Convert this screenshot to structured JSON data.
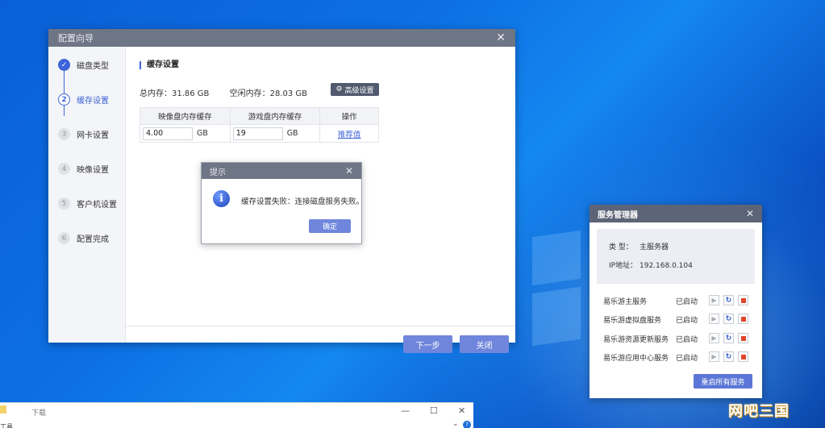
{
  "wizard": {
    "title": "配置向导",
    "steps": [
      {
        "num": "✓",
        "label": "磁盘类型",
        "state": "done"
      },
      {
        "num": "2",
        "label": "缓存设置",
        "state": "active"
      },
      {
        "num": "3",
        "label": "网卡设置",
        "state": "todo"
      },
      {
        "num": "4",
        "label": "映像设置",
        "state": "todo"
      },
      {
        "num": "5",
        "label": "客户机设置",
        "state": "todo"
      },
      {
        "num": "6",
        "label": "配置完成",
        "state": "todo"
      }
    ],
    "section_title": "缓存设置",
    "total_mem": "总内存：31.86 GB",
    "free_mem": "空闲内存：28.03 GB",
    "advanced_button": "高级设置",
    "table": {
      "headers": [
        "映像盘内存缓存",
        "游戏盘内存缓存",
        "操作"
      ],
      "image_cache_value": "4.00",
      "game_cache_value": "19",
      "unit": "GB",
      "action_link": "推荐值"
    },
    "next_button": "下一步",
    "close_button": "关闭"
  },
  "alert": {
    "title": "提示",
    "message": "缓存设置失败：连接磁盘服务失败。",
    "ok_button": "确定"
  },
  "service_manager": {
    "title": "服务管理器",
    "type_label": "类  型：",
    "type_value": "主服务器",
    "ip_label": "IP地址：",
    "ip_value": "192.168.0.104",
    "services": [
      {
        "name": "易乐游主服务",
        "status": "已启动"
      },
      {
        "name": "易乐游虚拟盘服务",
        "status": "已启动"
      },
      {
        "name": "易乐游资源更新服务",
        "status": "已启动"
      },
      {
        "name": "易乐游应用中心服务",
        "status": "已启动"
      }
    ],
    "restart_all_button": "重启所有服务"
  },
  "explorer": {
    "title": "下载",
    "left_label": "工具"
  },
  "watermark": "网吧三国",
  "colors": {
    "accent": "#3d64d8",
    "titlebar": "#6e7585",
    "button": "#6f86dc",
    "stop": "#e1462d"
  }
}
